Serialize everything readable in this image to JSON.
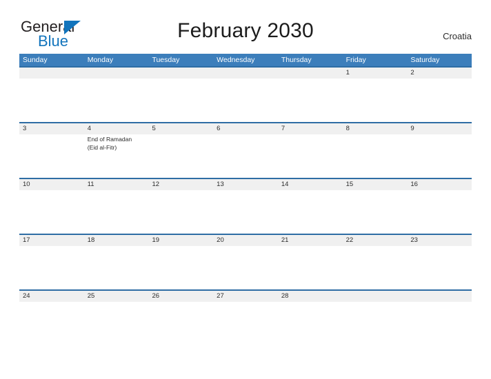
{
  "brand": {
    "name_part1": "General",
    "name_part2": "Blue",
    "triangle_icon": "triangle-icon",
    "color_dark": "#231f20",
    "color_blue": "#1274bc"
  },
  "header": {
    "title": "February 2030",
    "country": "Croatia"
  },
  "colors": {
    "header_blue": "#3c7ebb",
    "divider_blue": "#2e6da4",
    "band_gray": "#f0f0f0",
    "text": "#2b2b2b"
  },
  "weekdays": [
    "Sunday",
    "Monday",
    "Tuesday",
    "Wednesday",
    "Thursday",
    "Friday",
    "Saturday"
  ],
  "weeks": [
    {
      "days": [
        {
          "date": "",
          "event": ""
        },
        {
          "date": "",
          "event": ""
        },
        {
          "date": "",
          "event": ""
        },
        {
          "date": "",
          "event": ""
        },
        {
          "date": "",
          "event": ""
        },
        {
          "date": "1",
          "event": ""
        },
        {
          "date": "2",
          "event": ""
        }
      ]
    },
    {
      "days": [
        {
          "date": "3",
          "event": ""
        },
        {
          "date": "4",
          "event": "End of Ramadan\n(Eid al-Fitr)"
        },
        {
          "date": "5",
          "event": ""
        },
        {
          "date": "6",
          "event": ""
        },
        {
          "date": "7",
          "event": ""
        },
        {
          "date": "8",
          "event": ""
        },
        {
          "date": "9",
          "event": ""
        }
      ]
    },
    {
      "days": [
        {
          "date": "10",
          "event": ""
        },
        {
          "date": "11",
          "event": ""
        },
        {
          "date": "12",
          "event": ""
        },
        {
          "date": "13",
          "event": ""
        },
        {
          "date": "14",
          "event": ""
        },
        {
          "date": "15",
          "event": ""
        },
        {
          "date": "16",
          "event": ""
        }
      ]
    },
    {
      "days": [
        {
          "date": "17",
          "event": ""
        },
        {
          "date": "18",
          "event": ""
        },
        {
          "date": "19",
          "event": ""
        },
        {
          "date": "20",
          "event": ""
        },
        {
          "date": "21",
          "event": ""
        },
        {
          "date": "22",
          "event": ""
        },
        {
          "date": "23",
          "event": ""
        }
      ]
    },
    {
      "days": [
        {
          "date": "24",
          "event": ""
        },
        {
          "date": "25",
          "event": ""
        },
        {
          "date": "26",
          "event": ""
        },
        {
          "date": "27",
          "event": ""
        },
        {
          "date": "28",
          "event": ""
        },
        {
          "date": "",
          "event": ""
        },
        {
          "date": "",
          "event": ""
        }
      ]
    }
  ]
}
